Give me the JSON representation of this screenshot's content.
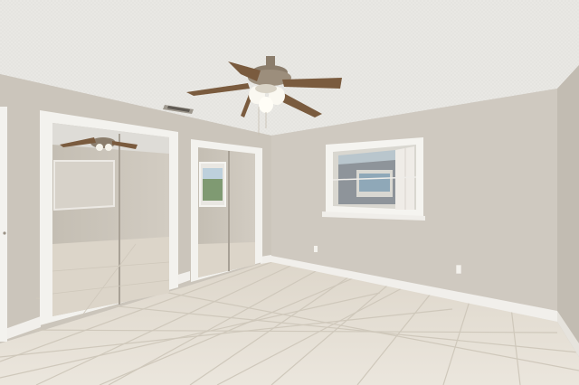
{
  "scene": {
    "colors": {
      "ceiling": "#e9e8e4",
      "wall": "#ccc6bd",
      "wall_shadow": "#bdb7ad",
      "trim": "#f3f2ee",
      "floor": "#e6e0d5",
      "grout": "#cdc6b9",
      "mirror": "#c9c3b8",
      "fan_blade": "#7a5b3e",
      "fan_metal": "#8b7d6c"
    }
  }
}
